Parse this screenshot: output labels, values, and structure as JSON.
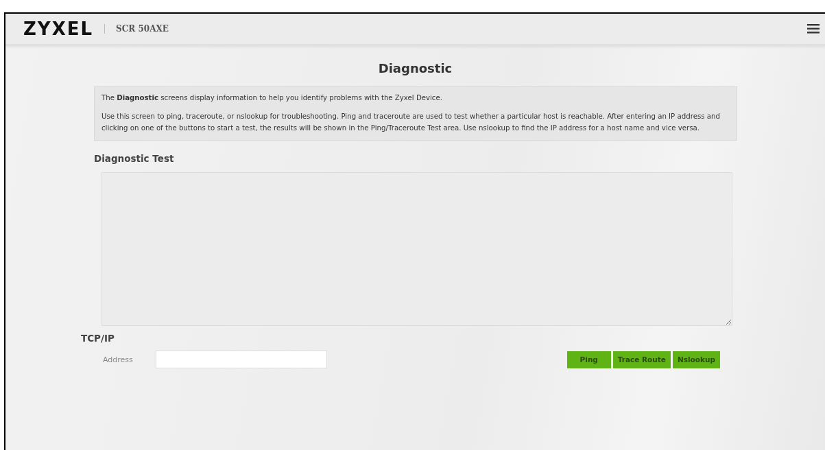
{
  "header": {
    "logo": "ZYXEL",
    "model": "SCR 50AXE"
  },
  "title": "Diagnostic",
  "info": {
    "intro": "The **Diagnostic** screens display information to help you identify problems with the Zyxel Device.",
    "body": "Use this screen to ping, traceroute, or nslookup for troubleshooting. Ping and traceroute are used to test whether a particular host is reachable. After entering an IP address and clicking on one of the buttons to start a test, the results will be shown in the Ping/Traceroute Test area. Use nslookup to find the IP address for a host name and vice versa."
  },
  "test_section": {
    "heading": "Diagnostic Test"
  },
  "tcpip": {
    "heading": "TCP/IP",
    "address_label": "Address",
    "buttons": [
      "Ping",
      "Trace Route",
      "Nslookup"
    ]
  }
}
